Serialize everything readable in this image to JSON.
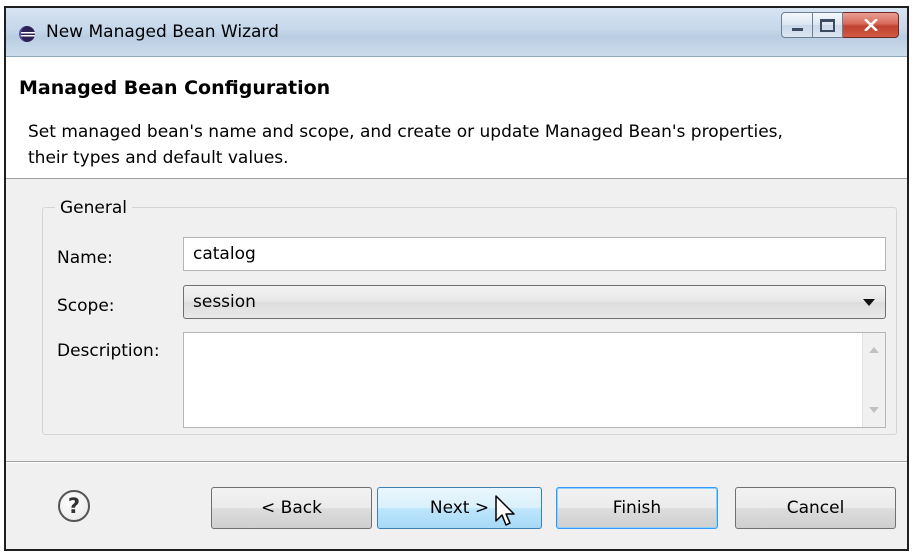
{
  "window": {
    "title": "New Managed Bean Wizard"
  },
  "header": {
    "title": "Managed Bean Configuration",
    "description": "Set managed bean's name and scope, and create or update Managed Bean's properties, their types and default values."
  },
  "general": {
    "legend": "General",
    "name_label": "Name:",
    "name_value": "catalog",
    "scope_label": "Scope:",
    "scope_value": "session",
    "description_label": "Description:",
    "description_value": ""
  },
  "buttons": {
    "back": "< Back",
    "next": "Next >",
    "finish": "Finish",
    "cancel": "Cancel"
  },
  "icons": {
    "window": "eclipse-icon",
    "help": "help-icon",
    "minimize": "minimize-icon",
    "maximize": "maximize-icon",
    "close": "close-icon",
    "dropdown": "chevron-down-icon",
    "cursor": "mouse-pointer-icon"
  },
  "colors": {
    "titlebar": "#c5d7ea",
    "close_button": "#c0412f",
    "next_button_highlight": "#bee6fd",
    "dialog_background": "#f0f0f0"
  }
}
